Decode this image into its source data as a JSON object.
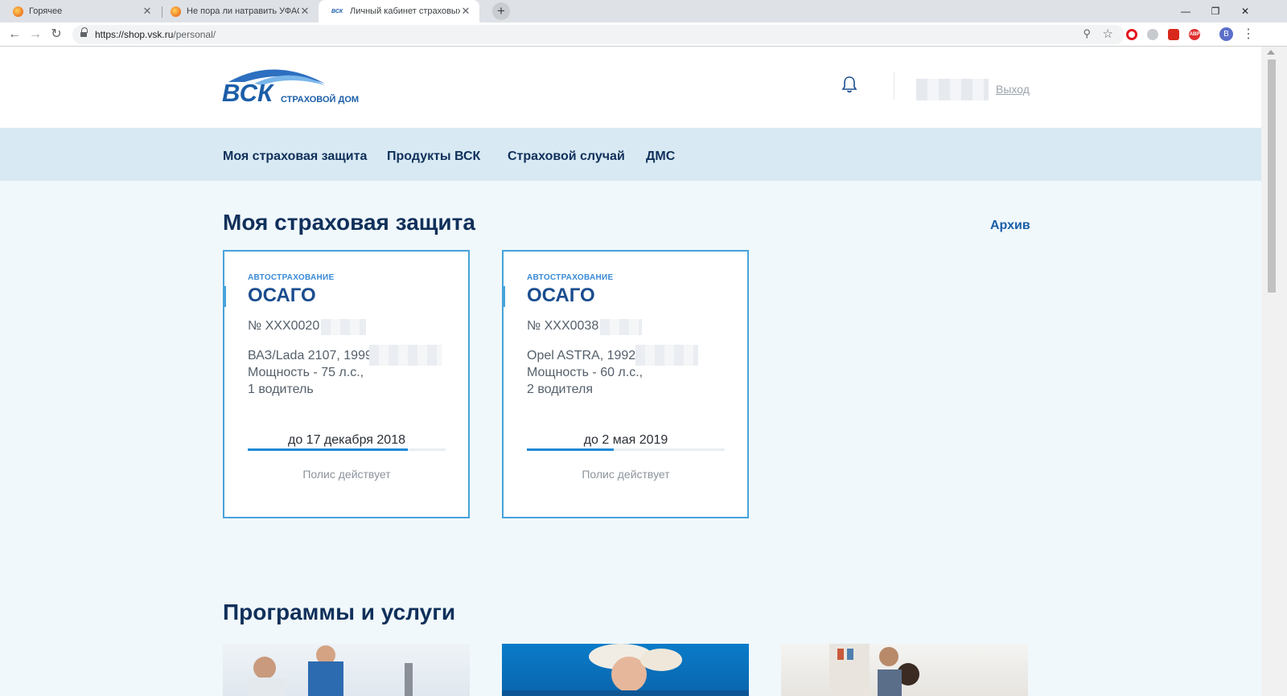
{
  "browser": {
    "tabs": [
      {
        "title": "Горячее",
        "active": false
      },
      {
        "title": "Не пора ли натравить УФАС на",
        "active": false
      },
      {
        "title": "Личный кабинет страховых про",
        "active": true
      }
    ],
    "url_host": "https://shop.vsk.ru",
    "url_path": "/personal/",
    "profile_initial": "B",
    "ext_abp": "ABP"
  },
  "header": {
    "logo_text": "ВСК",
    "logo_subtext": "СТРАХОВОЙ ДОМ",
    "logout_label": "Выход"
  },
  "nav": {
    "items": [
      "Моя страховая защита",
      "Продукты ВСК",
      "Страховой случай",
      "ДМС"
    ]
  },
  "insurance": {
    "title": "Моя страховая защита",
    "archive_label": "Архив",
    "cards": [
      {
        "category": "АВТОСТРАХОВАНИЕ",
        "name": "ОСАГО",
        "number": "№ XXX0020",
        "car": "ВАЗ/Lada 2107, 1999,",
        "power": "Мощность - 75 л.с.,",
        "drivers": "1 водитель",
        "until": "до 17 декабря 2018",
        "progress": 0.81,
        "status": "Полис действует"
      },
      {
        "category": "АВТОСТРАХОВАНИЕ",
        "name": "ОСАГО",
        "number": "№ XXX0038",
        "car": "Opel ASTRA, 1992,",
        "power": "Мощность - 60 л.с.,",
        "drivers": "2 водителя",
        "until": "до 2 мая 2019",
        "progress": 0.44,
        "status": "Полис действует"
      }
    ]
  },
  "programs": {
    "title": "Программы и услуги"
  },
  "colors": {
    "brand_dark": "#10305a",
    "brand_blue": "#1b5ea8",
    "accent": "#47a3d9",
    "nav_bg": "#d8e9f3",
    "page_bg": "#f0f8fc"
  }
}
